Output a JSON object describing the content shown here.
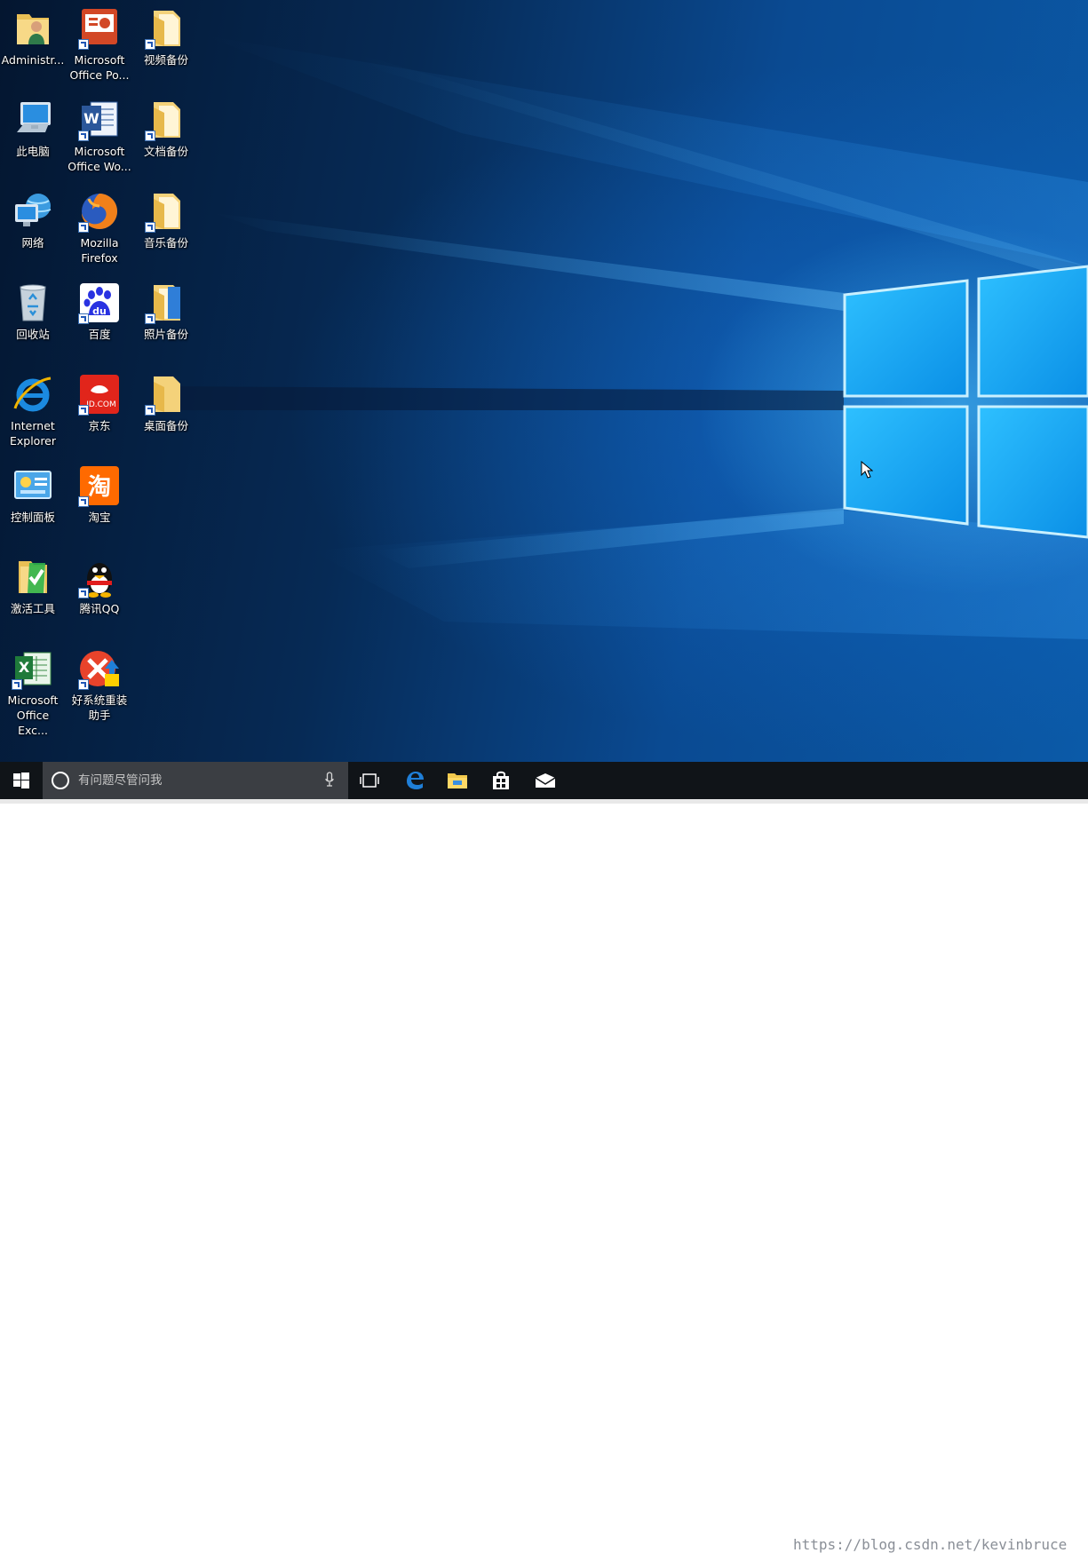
{
  "desktop": {
    "icons": [
      {
        "label": "Administr...",
        "icon": "user-folder-icon"
      },
      {
        "label": "此电脑",
        "icon": "computer-icon"
      },
      {
        "label": "网络",
        "icon": "network-icon"
      },
      {
        "label": "回收站",
        "icon": "recycle-bin-icon"
      },
      {
        "label": "Internet\nExplorer",
        "icon": "internet-explorer-icon"
      },
      {
        "label": "控制面板",
        "icon": "control-panel-icon"
      },
      {
        "label": "激活工具",
        "icon": "activation-tool-icon"
      },
      {
        "label": "Microsoft\nOffice Exc...",
        "icon": "excel-icon"
      },
      {
        "label": "Microsoft\nOffice Po...",
        "icon": "powerpoint-icon"
      },
      {
        "label": "Microsoft\nOffice Wo...",
        "icon": "word-icon"
      },
      {
        "label": "Mozilla\nFirefox",
        "icon": "firefox-icon"
      },
      {
        "label": "百度",
        "icon": "baidu-icon"
      },
      {
        "label": "京东",
        "icon": "jd-icon"
      },
      {
        "label": "淘宝",
        "icon": "taobao-icon"
      },
      {
        "label": "腾讯QQ",
        "icon": "qq-icon"
      },
      {
        "label": "好系统重装\n助手",
        "icon": "reinstall-assistant-icon"
      },
      {
        "label": "视频备份",
        "icon": "folder-icon"
      },
      {
        "label": "文档备份",
        "icon": "folder-icon"
      },
      {
        "label": "音乐备份",
        "icon": "folder-icon"
      },
      {
        "label": "照片备份",
        "icon": "folder-icon"
      },
      {
        "label": "桌面备份",
        "icon": "folder-icon"
      }
    ]
  },
  "icon_glyphs": {
    "baidu": "du",
    "jd": "JD.COM",
    "taobao": "淘",
    "excel": "X",
    "word": "W"
  },
  "taskbar": {
    "search_placeholder": "有问题尽管问我",
    "pinned": [
      "edge-icon",
      "file-explorer-icon",
      "store-icon",
      "mail-icon"
    ]
  },
  "watermark": "https://blog.csdn.net/kevinbruce",
  "colors": {
    "taskbar": "#101418",
    "search_box": "#3b3e43",
    "desktop_accent": "#2aa7f5",
    "edge_blue": "#1f7fd8",
    "folder_yellow": "#f4d27a"
  }
}
